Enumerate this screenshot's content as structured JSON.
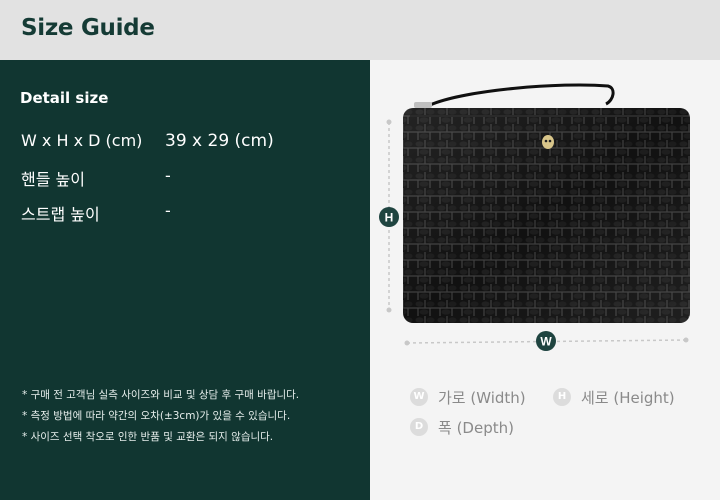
{
  "header": {
    "title": "Size Guide"
  },
  "detail": {
    "heading": "Detail size",
    "rows": [
      {
        "label": "W x H x D (cm)",
        "value": "39 x 29 (cm)"
      },
      {
        "label": "핸들 높이",
        "value": "-"
      },
      {
        "label": "스트랩 높이",
        "value": "-"
      }
    ],
    "notes": [
      "* 구매 전 고객님 실측 사이즈와 비교 및 상담 후 구매 바랍니다.",
      "* 측정 방법에 따라 약간의 오차(±3cm)가 있을 수 있습니다.",
      "* 사이즈 선택 착오로 인한 반품 및 교환은 되지 않습니다."
    ]
  },
  "dimension_markers": {
    "height": "H",
    "width": "W"
  },
  "legend": [
    {
      "badge": "W",
      "label": "가로 (Width)"
    },
    {
      "badge": "H",
      "label": "세로 (Height)"
    },
    {
      "badge": "D",
      "label": "폭 (Depth)"
    }
  ],
  "colors": {
    "header_bg": "#e2e2e2",
    "panel_dark": "#113631",
    "accent_title": "#153b35",
    "marker": "#1f4440",
    "bag_black": "#0b0b0b"
  }
}
